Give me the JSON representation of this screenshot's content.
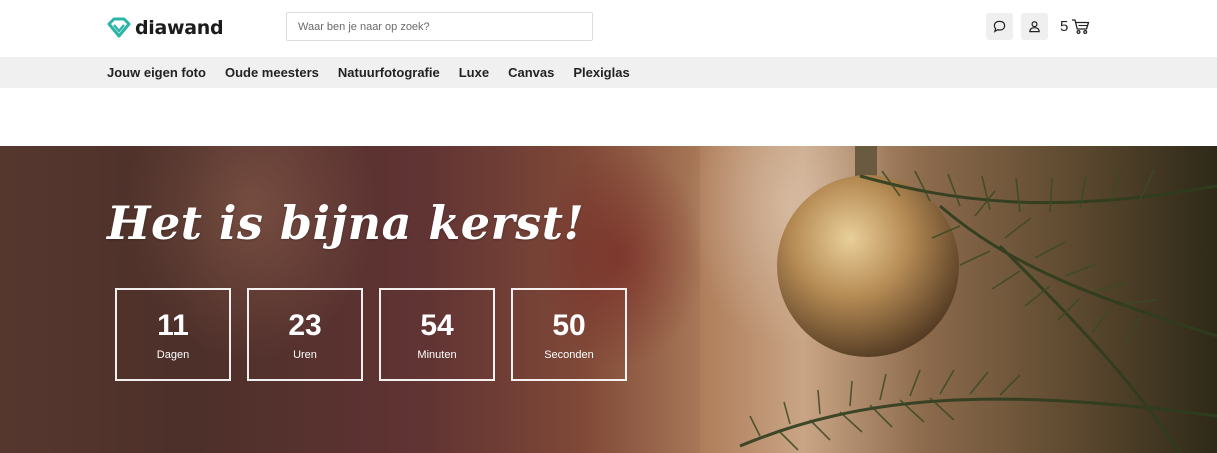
{
  "brand": {
    "name": "diawand",
    "accent": "#2bb5a8"
  },
  "search": {
    "placeholder": "Waar ben je naar op zoek?",
    "value": ""
  },
  "header": {
    "chat_icon": "chat-bubble-icon",
    "account_icon": "user-icon",
    "cart": {
      "count": "5",
      "icon": "shopping-cart-icon"
    }
  },
  "nav": {
    "items": [
      {
        "label": "Jouw eigen foto"
      },
      {
        "label": "Oude meesters"
      },
      {
        "label": "Natuurfotografie"
      },
      {
        "label": "Luxe"
      },
      {
        "label": "Canvas"
      },
      {
        "label": "Plexiglas"
      }
    ]
  },
  "hero": {
    "title": "Het is bijna kerst!",
    "countdown": [
      {
        "value": "11",
        "label": "Dagen"
      },
      {
        "value": "23",
        "label": "Uren"
      },
      {
        "value": "54",
        "label": "Minuten"
      },
      {
        "value": "50",
        "label": "Seconden"
      }
    ]
  }
}
